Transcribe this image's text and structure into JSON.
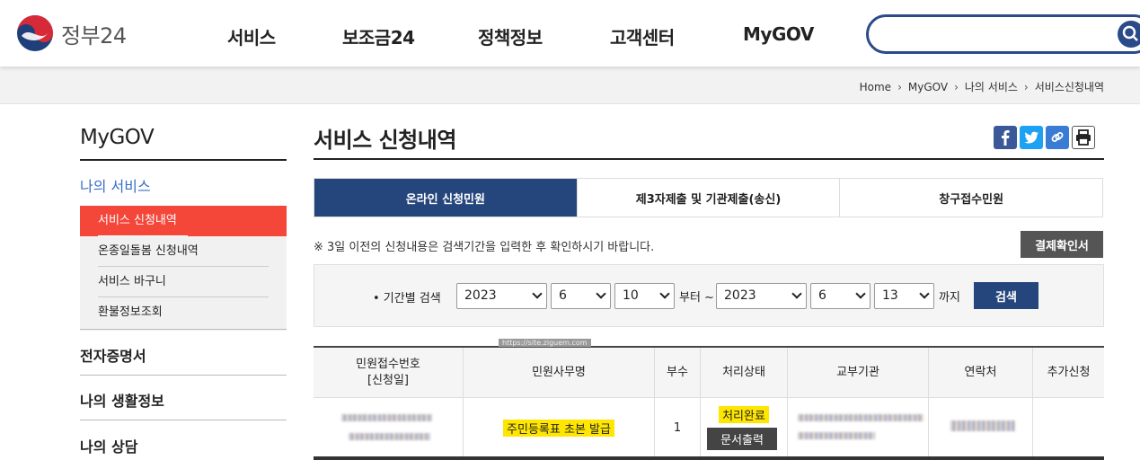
{
  "header": {
    "logo_text": "정부24",
    "nav": [
      "서비스",
      "보조금24",
      "정책정보",
      "고객센터",
      "MyGOV"
    ],
    "search_placeholder": ""
  },
  "breadcrumb": [
    "Home",
    "MyGOV",
    "나의 서비스",
    "서비스신청내역"
  ],
  "sidebar": {
    "title": "MyGOV",
    "active_section": "나의 서비스",
    "sub_items": [
      "서비스 신청내역",
      "온종일돌봄 신청내역",
      "서비스 바구니",
      "환불정보조회"
    ],
    "sections": [
      "전자증명서",
      "나의 생활정보",
      "나의 상담"
    ]
  },
  "main": {
    "title": "서비스 신청내역",
    "share_icons": [
      "facebook-icon",
      "twitter-icon",
      "link-icon",
      "print-icon"
    ],
    "tabs": [
      "온라인 신청민원",
      "제3자제출 및 기관제출(송신)",
      "창구접수민원"
    ],
    "notice": "※ 3일 이전의 신청내용은 검색기간을 입력한 후 확인하시기 바랍니다.",
    "confirm_button": "결제확인서",
    "search": {
      "label": "• 기간별 검색",
      "from_year": "2023",
      "from_month": "6",
      "from_day": "10",
      "from_text": "부터 ~",
      "to_year": "2023",
      "to_month": "6",
      "to_day": "13",
      "to_text": "까지",
      "button": "검색"
    },
    "table": {
      "headers": [
        "민원접수번호\n[신청일]",
        "민원사무명",
        "부수",
        "처리상태",
        "교부기관",
        "연락처",
        "추가신청"
      ],
      "rows": [
        {
          "service": "주민등록표 초본 발급",
          "copies": "1",
          "status": "처리완료",
          "print_button": "문서출력"
        }
      ]
    },
    "watermark": "https://site.ziguem.com"
  },
  "colors": {
    "brand_navy": "#25467c",
    "accent_red": "#f4473a",
    "highlight": "#ffe600"
  }
}
